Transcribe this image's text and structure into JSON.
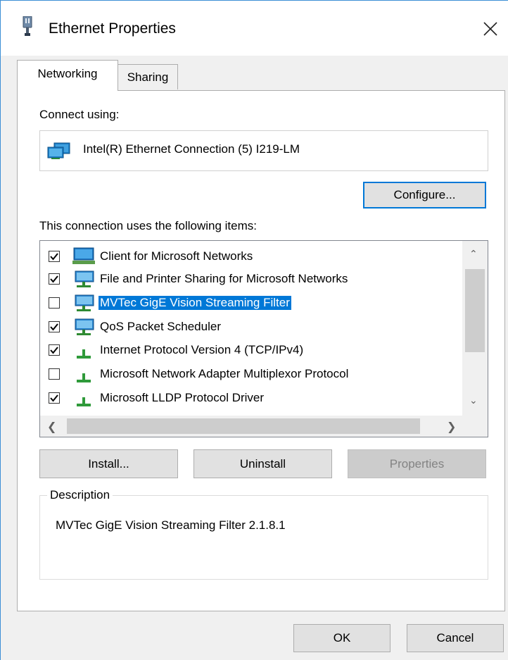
{
  "window": {
    "title": "Ethernet Properties",
    "title_icon": "network-adapter-icon",
    "close_icon": "close-icon",
    "accent_color": "#0078d7"
  },
  "tabs": [
    {
      "label": "Networking",
      "active": true
    },
    {
      "label": "Sharing",
      "active": false
    }
  ],
  "connect_using": {
    "label": "Connect using:",
    "adapter_name": "Intel(R) Ethernet Connection (5) I219-LM",
    "adapter_icon": "network-adapter-icon",
    "configure_label": "Configure..."
  },
  "items_section": {
    "label": "This connection uses the following items:",
    "items": [
      {
        "label": "Client for Microsoft Networks",
        "checked": true,
        "icon": "network-client-icon",
        "selected": false
      },
      {
        "label": "File and Printer Sharing for Microsoft Networks",
        "checked": true,
        "icon": "network-service-icon",
        "selected": false
      },
      {
        "label": "MVTec GigE Vision Streaming Filter",
        "checked": false,
        "icon": "network-service-icon",
        "selected": true
      },
      {
        "label": "QoS Packet Scheduler",
        "checked": true,
        "icon": "network-service-icon",
        "selected": false
      },
      {
        "label": "Internet Protocol Version 4 (TCP/IPv4)",
        "checked": true,
        "icon": "protocol-icon",
        "selected": false
      },
      {
        "label": "Microsoft Network Adapter Multiplexor Protocol",
        "checked": false,
        "icon": "protocol-icon",
        "selected": false
      },
      {
        "label": "Microsoft LLDP Protocol Driver",
        "checked": true,
        "icon": "protocol-icon",
        "selected": false
      }
    ]
  },
  "buttons": {
    "install": "Install...",
    "uninstall": "Uninstall",
    "properties": "Properties"
  },
  "description": {
    "title": "Description",
    "text": "MVTec GigE Vision Streaming Filter 2.1.8.1"
  },
  "footer": {
    "ok": "OK",
    "cancel": "Cancel"
  }
}
